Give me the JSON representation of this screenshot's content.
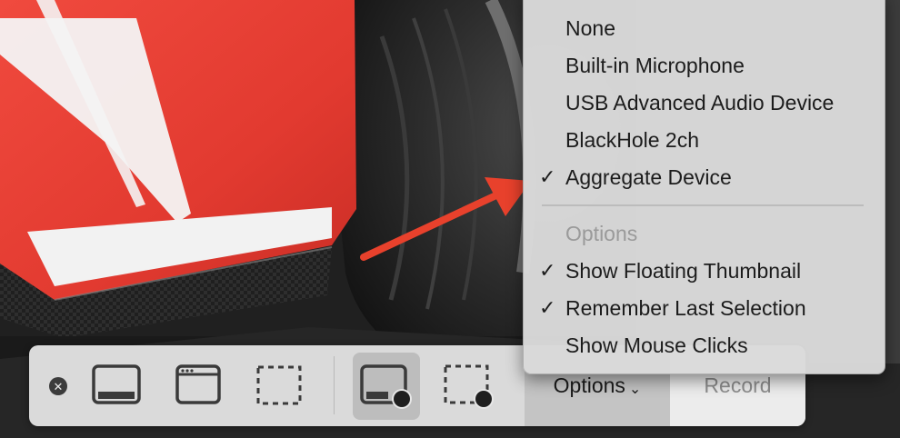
{
  "menu": {
    "items": [
      {
        "label": "None",
        "checked": false
      },
      {
        "label": "Built-in Microphone",
        "checked": false
      },
      {
        "label": "USB Advanced Audio Device",
        "checked": false
      },
      {
        "label": "BlackHole 2ch",
        "checked": false
      },
      {
        "label": "Aggregate Device",
        "checked": true
      }
    ],
    "options_header": "Options",
    "options": [
      {
        "label": "Show Floating Thumbnail",
        "checked": true
      },
      {
        "label": "Remember Last Selection",
        "checked": true
      },
      {
        "label": "Show Mouse Clicks",
        "checked": false
      }
    ],
    "check_glyph": "✓"
  },
  "toolbar": {
    "close_glyph": "✕",
    "tools": [
      {
        "name": "capture-entire-screen-icon"
      },
      {
        "name": "capture-window-icon"
      },
      {
        "name": "capture-selection-icon"
      },
      {
        "name": "record-entire-screen-icon",
        "selected": true
      },
      {
        "name": "record-selection-icon"
      }
    ],
    "options_label": "Options",
    "options_chevron": "⌄",
    "record_label": "Record"
  },
  "annotation": {
    "arrow_color": "#e8412c"
  }
}
